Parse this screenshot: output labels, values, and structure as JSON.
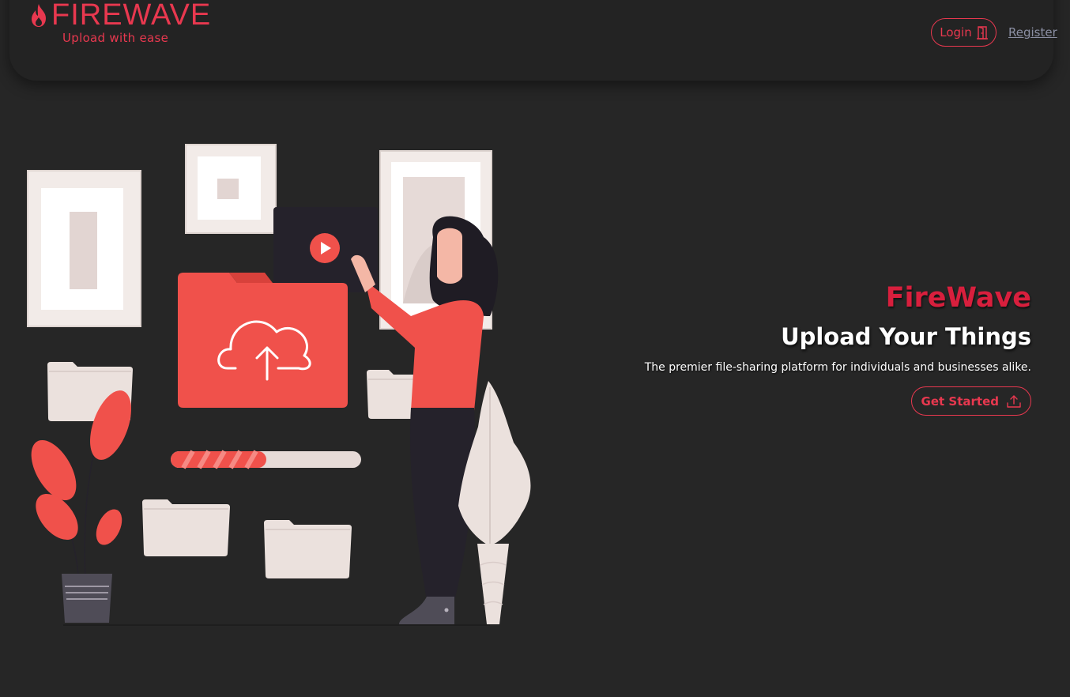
{
  "navbar": {
    "brand_name": "FIREWAVE",
    "brand_tagline": "Upload with ease",
    "login_label": "Login",
    "register_label": "Register",
    "login_icon": "door-icon",
    "brand_icon": "flame-icon"
  },
  "hero": {
    "brand": "FireWave",
    "title": "Upload Your Things",
    "subtitle": "The premier file-sharing platform for individuals and businesses alike.",
    "cta_label": "Get Started",
    "cta_icon": "upload-icon"
  },
  "illustration": {
    "upload_progress": 0.5
  },
  "colors": {
    "accent": "#e8384f",
    "hero_brand": "#d81f3d",
    "background": "#262626",
    "navbar": "#232323",
    "illustration_red": "#f0514b",
    "illustration_light": "#ebe1dd",
    "illustration_dark": "#25222b"
  }
}
